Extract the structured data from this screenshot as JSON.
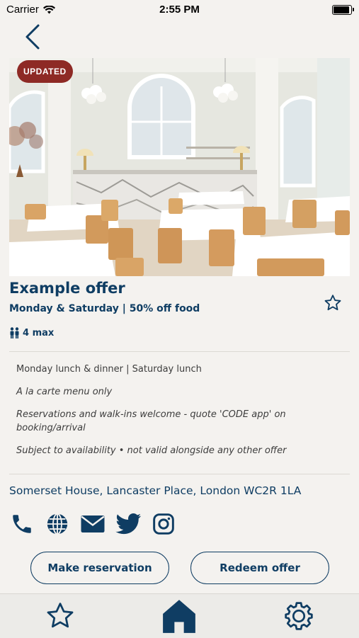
{
  "status_bar": {
    "carrier": "Carrier",
    "time": "2:55 PM"
  },
  "badge": "UPDATED",
  "offer": {
    "title": "Example offer",
    "subtitle": "Monday & Saturday | 50% off food",
    "max_guests": "4 max"
  },
  "details": [
    "Monday lunch & dinner | Saturday lunch",
    "A la carte menu only",
    "Reservations and walk-ins welcome - quote 'CODE app' on booking/arrival",
    "Subject to availability • not valid alongside any other offer"
  ],
  "address": "Somerset House, Lancaster Place, London WC2R 1LA",
  "contact_icons": [
    "phone-icon",
    "globe-icon",
    "email-icon",
    "twitter-icon",
    "instagram-icon"
  ],
  "buttons": {
    "reserve": "Make reservation",
    "redeem": "Redeem offer"
  },
  "tabbar": [
    "favorites-tab",
    "home-tab",
    "settings-tab"
  ],
  "colors": {
    "brand_navy": "#0f3d63",
    "badge_red": "#8e2a25",
    "background": "#f4f2ef"
  }
}
